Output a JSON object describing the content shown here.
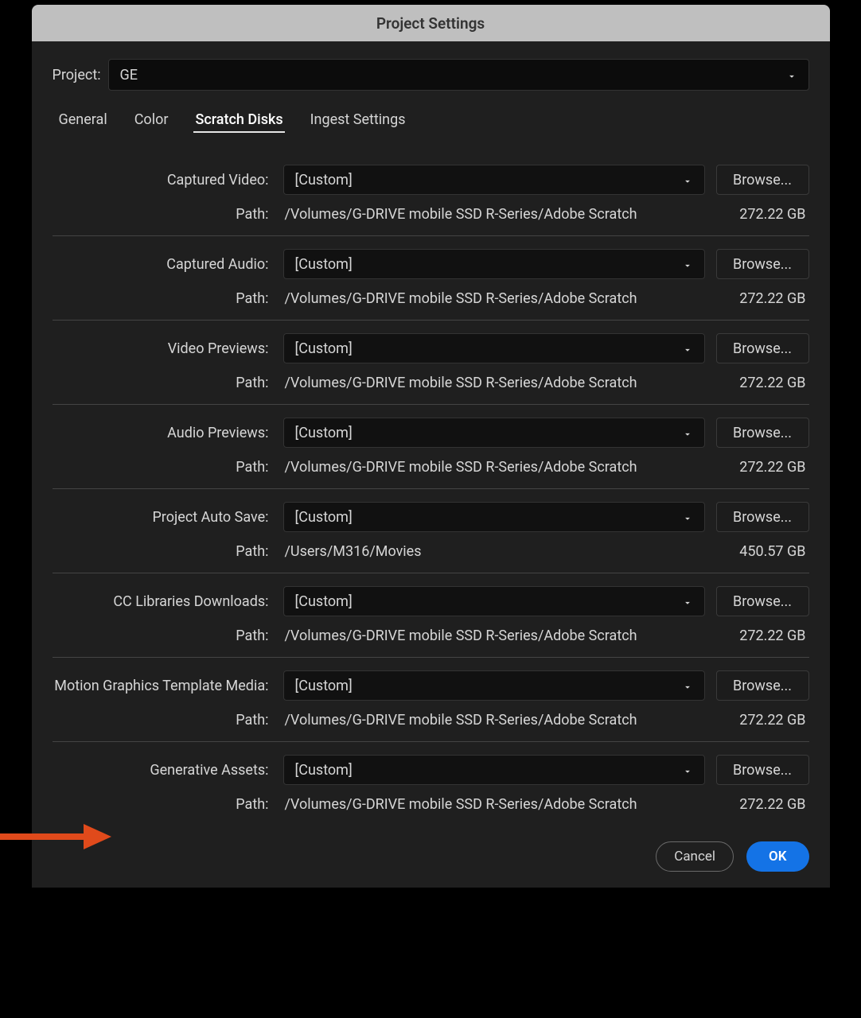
{
  "window_title": "Project Settings",
  "project": {
    "label": "Project:",
    "value": "GE"
  },
  "tabs": {
    "general": "General",
    "color": "Color",
    "scratch_disks": "Scratch Disks",
    "ingest_settings": "Ingest Settings",
    "active": "scratch_disks"
  },
  "common": {
    "browse": "Browse...",
    "path_label": "Path:"
  },
  "sections": [
    {
      "id": "captured_video",
      "label": "Captured Video:",
      "dropdown": "[Custom]",
      "path": "/Volumes/G-DRIVE mobile SSD R-Series/Adobe Scratch",
      "size": "272.22 GB"
    },
    {
      "id": "captured_audio",
      "label": "Captured Audio:",
      "dropdown": "[Custom]",
      "path": "/Volumes/G-DRIVE mobile SSD R-Series/Adobe Scratch",
      "size": "272.22 GB"
    },
    {
      "id": "video_previews",
      "label": "Video Previews:",
      "dropdown": "[Custom]",
      "path": "/Volumes/G-DRIVE mobile SSD R-Series/Adobe Scratch",
      "size": "272.22 GB"
    },
    {
      "id": "audio_previews",
      "label": "Audio Previews:",
      "dropdown": "[Custom]",
      "path": "/Volumes/G-DRIVE mobile SSD R-Series/Adobe Scratch",
      "size": "272.22 GB"
    },
    {
      "id": "project_auto_save",
      "label": "Project Auto Save:",
      "dropdown": "[Custom]",
      "path": "/Users/M316/Movies",
      "size": "450.57 GB"
    },
    {
      "id": "cc_libraries_downloads",
      "label": "CC Libraries Downloads:",
      "dropdown": "[Custom]",
      "path": "/Volumes/G-DRIVE mobile SSD R-Series/Adobe Scratch",
      "size": "272.22 GB"
    },
    {
      "id": "motion_graphics_template_media",
      "label": "Motion Graphics Template Media:",
      "dropdown": "[Custom]",
      "path": "/Volumes/G-DRIVE mobile SSD R-Series/Adobe Scratch",
      "size": "272.22 GB"
    },
    {
      "id": "generative_assets",
      "label": "Generative Assets:",
      "dropdown": "[Custom]",
      "path": "/Volumes/G-DRIVE mobile SSD R-Series/Adobe Scratch",
      "size": "272.22 GB"
    }
  ],
  "footer": {
    "cancel": "Cancel",
    "ok": "OK"
  }
}
